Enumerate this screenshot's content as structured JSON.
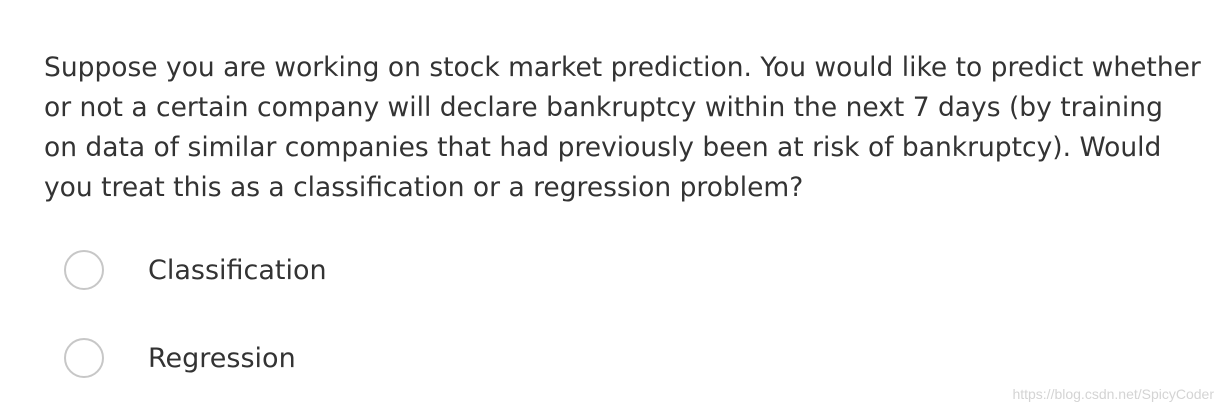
{
  "question": {
    "text": "Suppose you are working on stock market prediction. You would like to predict whether or not a certain company will declare bankruptcy within the next 7 days (by training on data of similar companies that had previously been at risk of bankruptcy). Would you treat this as a classification or a regression problem?"
  },
  "options": [
    {
      "label": "Classification",
      "selected": false
    },
    {
      "label": "Regression",
      "selected": false
    }
  ],
  "watermark": "https://blog.csdn.net/SpicyCoder"
}
